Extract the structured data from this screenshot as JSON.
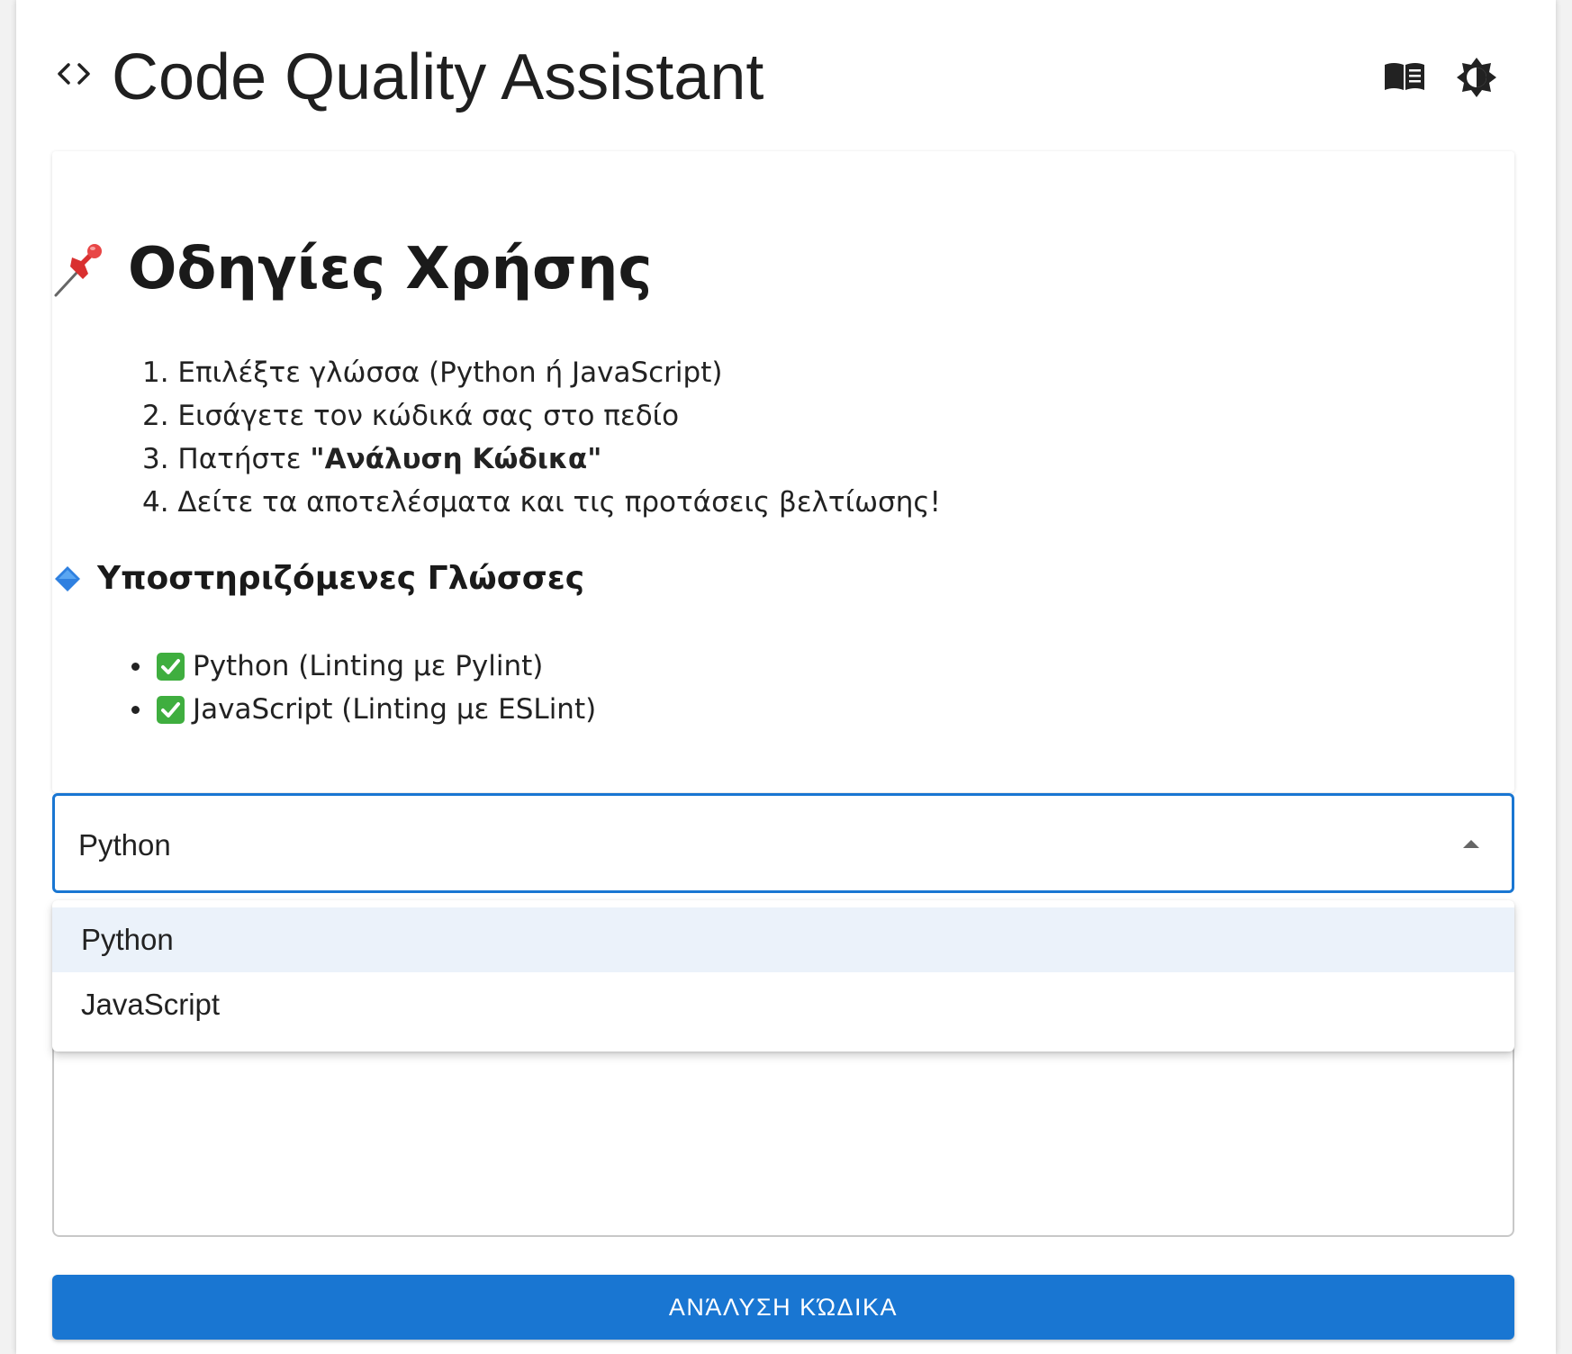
{
  "header": {
    "title": "Code Quality Assistant",
    "code_icon": "code-brackets-icon",
    "docs_icon": "open-book-icon",
    "theme_icon": "brightness-icon"
  },
  "instructions": {
    "heading_icon": "pushpin-emoji",
    "heading": "Οδηγίες Χρήσης",
    "steps": [
      {
        "prefix": "1. Επιλέξτε γλώσσα (Python ή JavaScript)",
        "bold": "",
        "suffix": ""
      },
      {
        "prefix": "2. Εισάγετε τον κώδικά σας στο πεδίο",
        "bold": "",
        "suffix": ""
      },
      {
        "prefix": "3. Πατήστε ",
        "bold": "\"Ανάλυση Κώδικα\"",
        "suffix": ""
      },
      {
        "prefix": "4. Δείτε τα αποτελέσματα και τις προτάσεις βελτίωσης!",
        "bold": "",
        "suffix": ""
      }
    ],
    "langs_icon": "blue-diamond-emoji",
    "langs_heading": "Υποστηριζόμενες Γλώσσες",
    "languages": [
      {
        "icon": "check-mark-button-emoji",
        "text": "Python (Linting με Pylint)"
      },
      {
        "icon": "check-mark-button-emoji",
        "text": "JavaScript (Linting με ESLint)"
      }
    ]
  },
  "language_select": {
    "value": "Python",
    "expanded": true,
    "options": [
      "Python",
      "JavaScript"
    ],
    "selected_index": 0
  },
  "code_input": {
    "value": ""
  },
  "analyze_button": {
    "label": "ΑΝΆΛΥΣΗ ΚΏΔΙΚΑ"
  },
  "colors": {
    "accent": "#1976d2",
    "selected_option_bg": "#ebf2fa",
    "text": "#212121"
  }
}
